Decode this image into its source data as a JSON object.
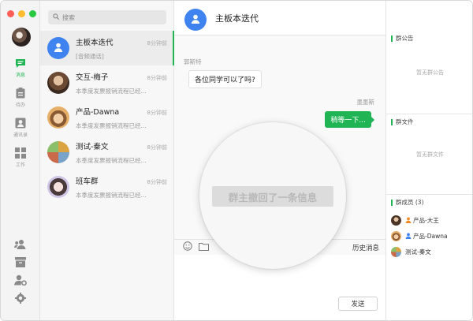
{
  "search": {
    "placeholder": "搜索"
  },
  "rail": {
    "items": [
      {
        "label": "消息",
        "icon": "chat-bubble-icon",
        "active": true
      },
      {
        "label": "待办",
        "icon": "clipboard-icon",
        "active": false
      },
      {
        "label": "通讯录",
        "icon": "contacts-icon",
        "active": false
      },
      {
        "label": "工作",
        "icon": "apps-grid-icon",
        "active": false
      }
    ],
    "bottom_icons": [
      "group-add-icon",
      "archive-icon",
      "user-settings-icon",
      "settings-gear-icon"
    ]
  },
  "conversations": [
    {
      "name": "主板本迭代",
      "time": "8分钟前",
      "preview": "[音频通话]",
      "active": true
    },
    {
      "name": "交互-梅子",
      "time": "8分钟前",
      "preview": "本季度发票报销流程已经...",
      "active": false
    },
    {
      "name": "产品-Dawna",
      "time": "8分钟前",
      "preview": "本季度发票报销流程已经...",
      "active": false
    },
    {
      "name": "测试-秦文",
      "time": "8分钟前",
      "preview": "本季度发票报销流程已经...",
      "active": false
    },
    {
      "name": "班车群",
      "time": "8分钟前",
      "preview": "本季度发票报销流程已经...",
      "active": false
    }
  ],
  "chat": {
    "title": "主板本迭代",
    "messages": [
      {
        "sender": "郭斯特",
        "text": "各位同学可以了吗?",
        "side": "left"
      },
      {
        "sender": "墨墨斯",
        "text": "稍等一下...",
        "side": "right"
      }
    ],
    "system_notice": "群主撤回了一条信息",
    "history_label": "历史消息",
    "send_label": "发送"
  },
  "info": {
    "announcement_title": "群公告",
    "announcement_empty": "暂无群公告",
    "files_title": "群文件",
    "files_empty": "暂无群文件",
    "members_title": "群成员 (3)",
    "members": [
      {
        "name": "产品-大王",
        "badge": "orange"
      },
      {
        "name": "产品-Dawna",
        "badge": "blue"
      },
      {
        "name": "测试-秦文",
        "badge": "none"
      }
    ]
  },
  "colors": {
    "accent": "#20b454",
    "group_avatar": "#3f83f0",
    "owner_badge": "#f08a24",
    "admin_badge": "#3f83f0"
  }
}
